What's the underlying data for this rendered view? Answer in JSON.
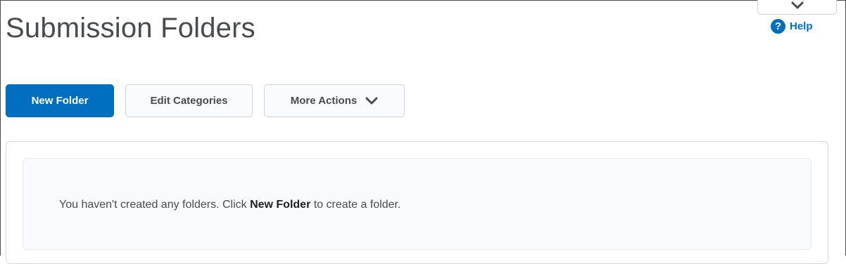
{
  "page": {
    "title": "Submission Folders"
  },
  "help": {
    "label": "Help",
    "icon": "question-circle-icon",
    "glyph": "?"
  },
  "toolbar": {
    "new_folder_label": "New Folder",
    "edit_categories_label": "Edit Categories",
    "more_actions_label": "More Actions"
  },
  "empty_state": {
    "text_before": "You haven't created any folders. Click ",
    "text_bold": "New Folder",
    "text_after": " to create a folder."
  },
  "colors": {
    "primary": "#006fbf",
    "title_text": "#494c4e",
    "border": "#cdd5dc",
    "empty_bg": "#f9fafd"
  }
}
